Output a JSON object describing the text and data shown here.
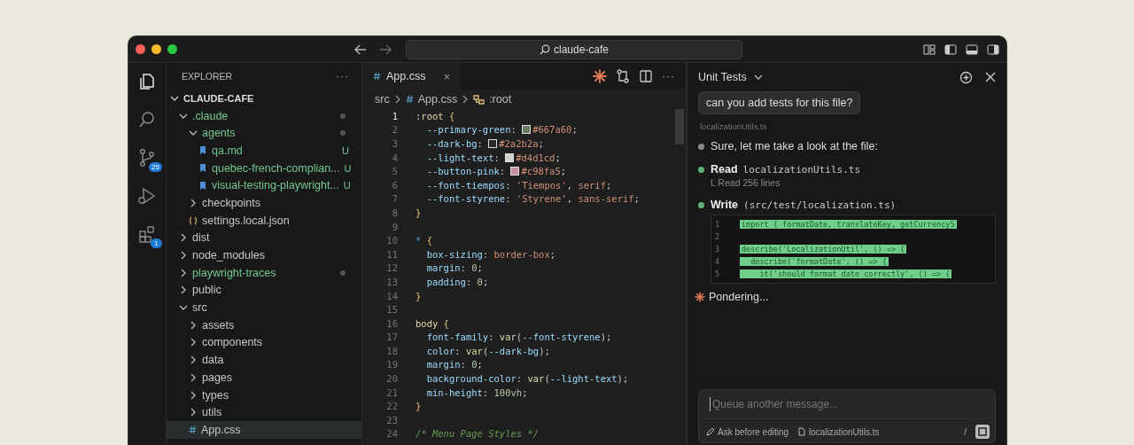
{
  "titlebar": {
    "search": "claude-cafe"
  },
  "activity_bar": [
    {
      "kind": "files",
      "selected": true
    },
    {
      "kind": "search",
      "selected": false
    },
    {
      "kind": "source-control",
      "selected": false,
      "badge": "25"
    },
    {
      "kind": "run",
      "selected": false
    },
    {
      "kind": "extensions",
      "selected": false,
      "badge": "1"
    }
  ],
  "explorer": {
    "title": "EXPLORER",
    "more": "···",
    "root": "CLAUDE-CAFE",
    "root_expanded": true,
    "tree": [
      {
        "label": ".claude",
        "kind": "folder",
        "expanded": true,
        "untracked": true,
        "dot": true,
        "selected": false,
        "children": [
          {
            "label": "agents",
            "kind": "folder",
            "expanded": true,
            "untracked": true,
            "dot": true,
            "selected": false,
            "children": [
              {
                "label": "qa.md",
                "kind": "md",
                "untracked": true,
                "dot": false,
                "badge": "U",
                "selected": false
              },
              {
                "label": "quebec-french-complian...",
                "kind": "md",
                "untracked": true,
                "dot": false,
                "badge": "U",
                "selected": false
              },
              {
                "label": "visual-testing-playwright...",
                "kind": "md",
                "untracked": true,
                "dot": false,
                "badge": "U",
                "selected": false
              }
            ]
          },
          {
            "label": "checkpoints",
            "kind": "folder",
            "expanded": false,
            "untracked": false,
            "dot": false,
            "selected": false
          },
          {
            "label": "settings.local.json",
            "kind": "json",
            "untracked": false,
            "dot": false,
            "selected": false
          }
        ]
      },
      {
        "label": "dist",
        "kind": "folder",
        "expanded": false,
        "untracked": false,
        "dot": false,
        "selected": false
      },
      {
        "label": "node_modules",
        "kind": "folder",
        "expanded": false,
        "untracked": false,
        "dot": false,
        "selected": false
      },
      {
        "label": "playwright-traces",
        "kind": "folder",
        "expanded": false,
        "untracked": true,
        "dot": true,
        "selected": false
      },
      {
        "label": "public",
        "kind": "folder",
        "expanded": false,
        "untracked": false,
        "dot": false,
        "selected": false
      },
      {
        "label": "src",
        "kind": "folder",
        "expanded": true,
        "untracked": false,
        "dot": false,
        "selected": false,
        "children": [
          {
            "label": "assets",
            "kind": "folder",
            "expanded": false,
            "untracked": false,
            "dot": false,
            "selected": false
          },
          {
            "label": "components",
            "kind": "folder",
            "expanded": false,
            "untracked": false,
            "dot": false,
            "selected": false
          },
          {
            "label": "data",
            "kind": "folder",
            "expanded": false,
            "untracked": false,
            "dot": false,
            "selected": false
          },
          {
            "label": "pages",
            "kind": "folder",
            "expanded": false,
            "untracked": false,
            "dot": false,
            "selected": false
          },
          {
            "label": "types",
            "kind": "folder",
            "expanded": false,
            "untracked": false,
            "dot": false,
            "selected": false
          },
          {
            "label": "utils",
            "kind": "folder",
            "expanded": false,
            "untracked": false,
            "dot": false,
            "selected": false
          },
          {
            "label": "App.css",
            "kind": "css",
            "untracked": false,
            "dot": false,
            "selected": true
          }
        ]
      }
    ]
  },
  "editor": {
    "tab": {
      "label": "App.css",
      "close": "×",
      "selected": true
    },
    "breadcrumb": [
      {
        "kind": "folder",
        "label": "src"
      },
      {
        "kind": "css",
        "label": "App.css"
      },
      {
        "kind": "symbol",
        "label": ":root"
      }
    ],
    "more": "···",
    "lines": [
      {
        "n": "1",
        "current": true,
        "tokens": [
          {
            "kind": "sel",
            "text": ":root "
          },
          {
            "kind": "brace",
            "text": "{"
          }
        ]
      },
      {
        "n": "2",
        "current": false,
        "tokens": [
          {
            "kind": "prop",
            "text": "  --primary-green"
          },
          {
            "kind": "punc",
            "text": ": "
          },
          {
            "kind": "swatch",
            "color": "#667a60"
          },
          {
            "kind": "val",
            "text": "#667a60"
          },
          {
            "kind": "punc",
            "text": ";"
          }
        ]
      },
      {
        "n": "3",
        "current": false,
        "tokens": [
          {
            "kind": "prop",
            "text": "  --dark-bg"
          },
          {
            "kind": "punc",
            "text": ": "
          },
          {
            "kind": "swatch",
            "color": "#2a2b2a"
          },
          {
            "kind": "val",
            "text": "#2a2b2a"
          },
          {
            "kind": "punc",
            "text": ";"
          }
        ]
      },
      {
        "n": "4",
        "current": false,
        "tokens": [
          {
            "kind": "prop",
            "text": "  --light-text"
          },
          {
            "kind": "punc",
            "text": ": "
          },
          {
            "kind": "swatch",
            "color": "#d4d1cd"
          },
          {
            "kind": "val",
            "text": "#d4d1cd"
          },
          {
            "kind": "punc",
            "text": ";"
          }
        ]
      },
      {
        "n": "5",
        "current": false,
        "tokens": [
          {
            "kind": "prop",
            "text": "  --button-pink"
          },
          {
            "kind": "punc",
            "text": ": "
          },
          {
            "kind": "swatch",
            "color": "#c98fa5"
          },
          {
            "kind": "val",
            "text": "#c98fa5"
          },
          {
            "kind": "punc",
            "text": ";"
          }
        ]
      },
      {
        "n": "6",
        "current": false,
        "tokens": [
          {
            "kind": "prop",
            "text": "  --font-tiempos"
          },
          {
            "kind": "punc",
            "text": ": "
          },
          {
            "kind": "val",
            "text": "'Tiempos'"
          },
          {
            "kind": "punc",
            "text": ", "
          },
          {
            "kind": "val",
            "text": "serif"
          },
          {
            "kind": "punc",
            "text": ";"
          }
        ]
      },
      {
        "n": "7",
        "current": false,
        "tokens": [
          {
            "kind": "prop",
            "text": "  --font-styrene"
          },
          {
            "kind": "punc",
            "text": ": "
          },
          {
            "kind": "val",
            "text": "'Styrene'"
          },
          {
            "kind": "punc",
            "text": ", "
          },
          {
            "kind": "val",
            "text": "sans-serif"
          },
          {
            "kind": "punc",
            "text": ";"
          }
        ]
      },
      {
        "n": "8",
        "current": false,
        "tokens": [
          {
            "kind": "brace",
            "text": "}"
          }
        ]
      },
      {
        "n": "9",
        "current": false
      },
      {
        "n": "10",
        "current": false,
        "tokens": [
          {
            "kind": "star",
            "text": "* "
          },
          {
            "kind": "brace",
            "text": "{"
          }
        ]
      },
      {
        "n": "11",
        "current": false,
        "tokens": [
          {
            "kind": "prop",
            "text": "  box-sizing"
          },
          {
            "kind": "punc",
            "text": ": "
          },
          {
            "kind": "val",
            "text": "border-box"
          },
          {
            "kind": "punc",
            "text": ";"
          }
        ]
      },
      {
        "n": "12",
        "current": false,
        "tokens": [
          {
            "kind": "prop",
            "text": "  margin"
          },
          {
            "kind": "punc",
            "text": ": "
          },
          {
            "kind": "num",
            "text": "0"
          },
          {
            "kind": "punc",
            "text": ";"
          }
        ]
      },
      {
        "n": "13",
        "current": false,
        "tokens": [
          {
            "kind": "prop",
            "text": "  padding"
          },
          {
            "kind": "punc",
            "text": ": "
          },
          {
            "kind": "num",
            "text": "0"
          },
          {
            "kind": "punc",
            "text": ";"
          }
        ]
      },
      {
        "n": "14",
        "current": false,
        "tokens": [
          {
            "kind": "brace",
            "text": "}"
          }
        ]
      },
      {
        "n": "15",
        "current": false
      },
      {
        "n": "16",
        "current": false,
        "tokens": [
          {
            "kind": "sel",
            "text": "body "
          },
          {
            "kind": "brace",
            "text": "{"
          }
        ]
      },
      {
        "n": "17",
        "current": false,
        "tokens": [
          {
            "kind": "prop",
            "text": "  font-family"
          },
          {
            "kind": "punc",
            "text": ": "
          },
          {
            "kind": "func",
            "text": "var"
          },
          {
            "kind": "punc",
            "text": "("
          },
          {
            "kind": "prop",
            "text": "--font-styrene"
          },
          {
            "kind": "punc",
            "text": ");"
          }
        ]
      },
      {
        "n": "18",
        "current": false,
        "tokens": [
          {
            "kind": "prop",
            "text": "  color"
          },
          {
            "kind": "punc",
            "text": ": "
          },
          {
            "kind": "func",
            "text": "var"
          },
          {
            "kind": "punc",
            "text": "("
          },
          {
            "kind": "prop",
            "text": "--dark-bg"
          },
          {
            "kind": "punc",
            "text": ");"
          }
        ]
      },
      {
        "n": "19",
        "current": false,
        "tokens": [
          {
            "kind": "prop",
            "text": "  margin"
          },
          {
            "kind": "punc",
            "text": ": "
          },
          {
            "kind": "num",
            "text": "0"
          },
          {
            "kind": "punc",
            "text": ";"
          }
        ]
      },
      {
        "n": "20",
        "current": false,
        "tokens": [
          {
            "kind": "prop",
            "text": "  background-color"
          },
          {
            "kind": "punc",
            "text": ": "
          },
          {
            "kind": "func",
            "text": "var"
          },
          {
            "kind": "punc",
            "text": "("
          },
          {
            "kind": "prop",
            "text": "--light-text"
          },
          {
            "kind": "punc",
            "text": ");"
          }
        ]
      },
      {
        "n": "21",
        "current": false,
        "tokens": [
          {
            "kind": "prop",
            "text": "  min-height"
          },
          {
            "kind": "punc",
            "text": ": "
          },
          {
            "kind": "num",
            "text": "100vh"
          },
          {
            "kind": "punc",
            "text": ";"
          }
        ]
      },
      {
        "n": "22",
        "current": false,
        "tokens": [
          {
            "kind": "brace",
            "text": "}"
          }
        ]
      },
      {
        "n": "23",
        "current": false
      },
      {
        "n": "24",
        "current": false,
        "tokens": [
          {
            "kind": "comment",
            "text": "/* Menu Page Styles */"
          }
        ]
      }
    ]
  },
  "chat": {
    "title": "Unit Tests",
    "user_message": "can you add tests for this file?",
    "context_file": "localizationUtils.ts",
    "steps": [
      {
        "kind": "text",
        "color": "#8a8a8a",
        "text": "Sure, let me take a look at the file:"
      },
      {
        "kind": "tool",
        "color": "#5fb27a",
        "action": "Read",
        "target": "localizationUtils.ts",
        "detail": "L Read 256 lines"
      },
      {
        "kind": "tool",
        "color": "#5fb27a",
        "action": "Write",
        "target": "(src/test/localization.ts)",
        "diff": [
          {
            "n": "1",
            "text": "import { formatDate, translateKey, getCurrencyS"
          },
          {
            "n": "2"
          },
          {
            "n": "3",
            "text": "describe('LocalizationUtil', () => {"
          },
          {
            "n": "4",
            "text": "  describe('formatDate', () => {"
          },
          {
            "n": "5",
            "text": "    it('should format date correctly', () => {"
          }
        ]
      }
    ],
    "status": "Pondering...",
    "input": {
      "placeholder": "Queue another message..."
    },
    "footer": {
      "mode": "Ask before editing",
      "file": "localizationUtils.ts",
      "slash": "/"
    }
  }
}
